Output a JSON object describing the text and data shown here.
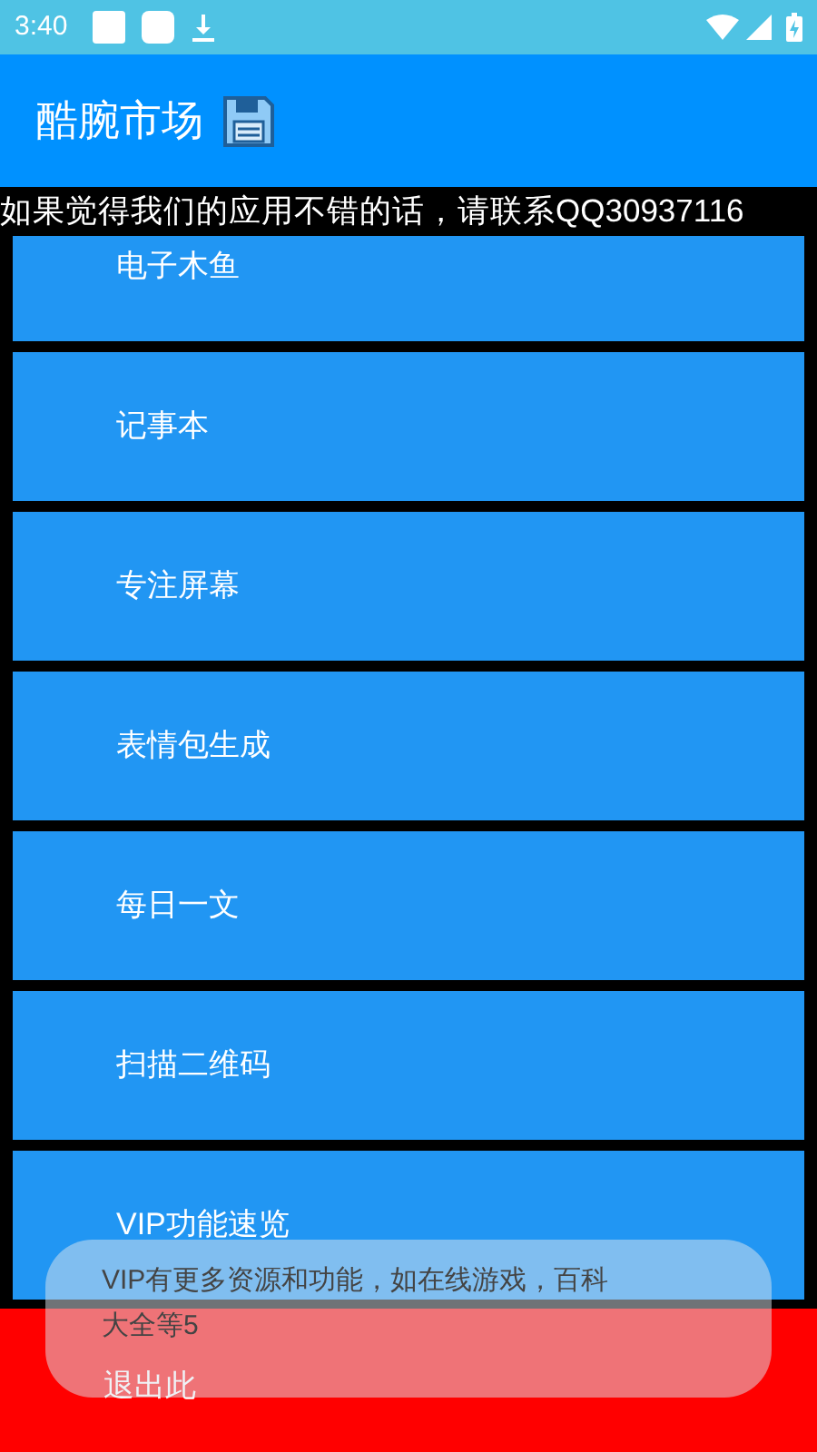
{
  "status_bar": {
    "time": "3:40"
  },
  "app_bar": {
    "title": "酷腕市场"
  },
  "marquee": "如果觉得我们的应用不错的话，请联系QQ30937116",
  "items": [
    {
      "label": "电子木鱼",
      "kind": "menu"
    },
    {
      "label": "记事本",
      "kind": "menu"
    },
    {
      "label": "专注屏幕",
      "kind": "menu"
    },
    {
      "label": "表情包生成",
      "kind": "menu"
    },
    {
      "label": "每日一文",
      "kind": "menu"
    },
    {
      "label": "扫描二维码",
      "kind": "menu"
    },
    {
      "label": "VIP功能速览",
      "kind": "menu"
    },
    {
      "label": "退出此",
      "kind": "exit"
    }
  ],
  "toast": {
    "lines": [
      "VIP有更多资源和功能，如在线游戏，百科",
      "大全等5"
    ]
  }
}
